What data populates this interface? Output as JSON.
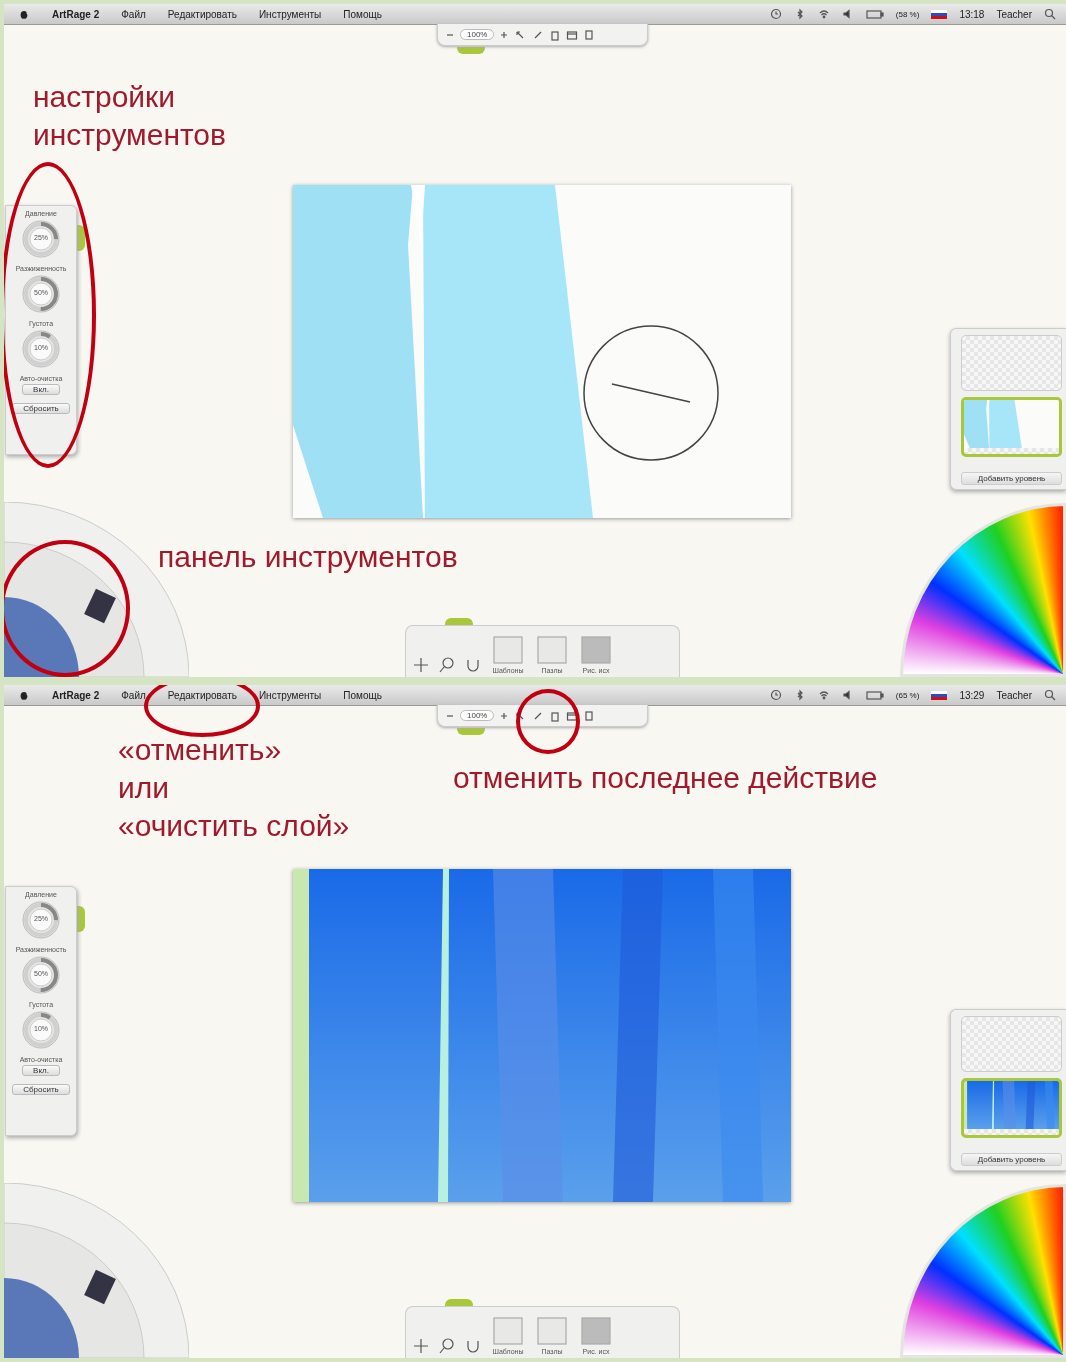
{
  "screens": [
    {
      "menu_bar": {
        "app": "ArtRage 2",
        "menus": [
          "Файл",
          "Редактировать",
          "Инструменты",
          "Помощь"
        ],
        "battery": "(58 %)",
        "time": "13:18",
        "user": "Teacher"
      },
      "zoom_value": "100%",
      "tool_settings": {
        "dials": [
          {
            "label": "Давление",
            "value": "25%",
            "level": 0.25
          },
          {
            "label": "Разжиженность",
            "value": "50%",
            "level": 0.5
          },
          {
            "label": "Густота",
            "value": "10%",
            "level": 0.1
          }
        ],
        "auto_clean_label": "Авто-очистка",
        "auto_clean_value": "Вкл.",
        "reset": "Сбросить"
      },
      "canvas": {
        "kind": "light-strokes"
      },
      "layers": {
        "add_layer": "Добавить уровень"
      },
      "bottom_toolbar": [
        "Шаблоны",
        "Пазлы",
        "Рис. исх"
      ],
      "annotations": [
        {
          "kind": "tool-settings",
          "lines": [
            "настройки",
            "инструментов"
          ]
        },
        {
          "kind": "toolbox",
          "lines": [
            "панель инструментов"
          ]
        }
      ]
    },
    {
      "menu_bar": {
        "app": "ArtRage 2",
        "menus": [
          "Файл",
          "Редактировать",
          "Инструменты",
          "Помощь"
        ],
        "battery": "(65 %)",
        "time": "13:29",
        "user": "Teacher"
      },
      "zoom_value": "100%",
      "tool_settings": {
        "dials": [
          {
            "label": "Давление",
            "value": "25%",
            "level": 0.25
          },
          {
            "label": "Разжиженность",
            "value": "50%",
            "level": 0.5
          },
          {
            "label": "Густота",
            "value": "10%",
            "level": 0.1
          }
        ],
        "auto_clean_label": "Авто-очистка",
        "auto_clean_value": "Вкл.",
        "reset": "Сбросить"
      },
      "canvas": {
        "kind": "blue-strokes"
      },
      "layers": {
        "add_layer": "Добавить уровень"
      },
      "bottom_toolbar": [
        "Шаблоны",
        "Пазлы",
        "Рис. исх"
      ],
      "annotations": [
        {
          "kind": "edit-menu",
          "lines": [
            "«отменить»",
            "или",
            "«очистить слой»"
          ]
        },
        {
          "kind": "undo",
          "lines": [
            "отменить последнее действие"
          ]
        }
      ]
    }
  ]
}
